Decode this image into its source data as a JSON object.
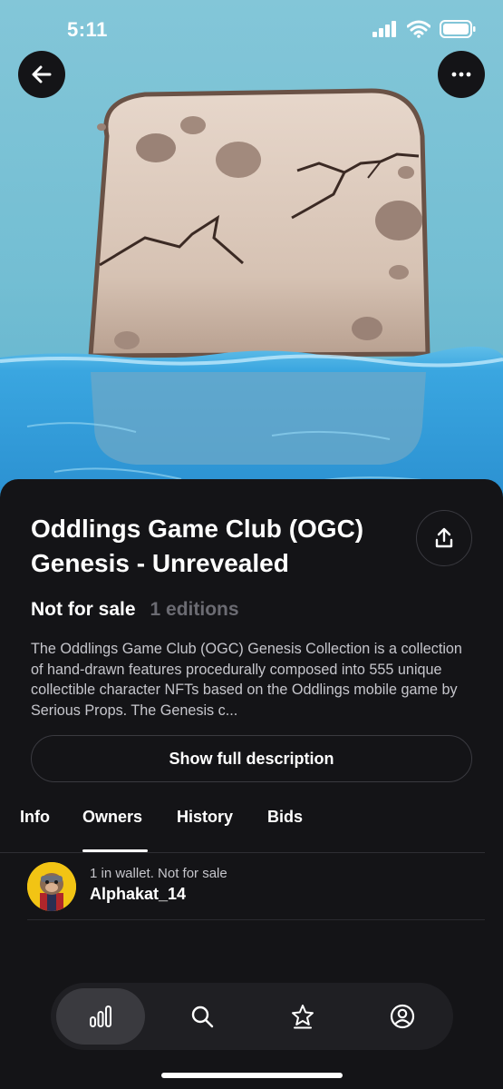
{
  "status_bar": {
    "time": "5:11",
    "icons": [
      "cellular-signal-icon",
      "wifi-icon",
      "battery-icon"
    ]
  },
  "hero": {
    "description_icons": [
      "back-arrow-icon",
      "more-dots-icon"
    ]
  },
  "nft": {
    "title": "Oddlings Game Club (OGC) Genesis - Unrevealed",
    "sale_status": "Not for sale",
    "editions": "1 editions",
    "description": "The Oddlings Game Club (OGC) Genesis Collection is a collection of hand-drawn features procedurally composed into 555 unique collectible character NFTs based on the Oddlings mobile game by Serious Props.  The Genesis c...",
    "show_description_label": "Show full description"
  },
  "tabs": [
    {
      "label": "Info",
      "active": false
    },
    {
      "label": "Owners",
      "active": true
    },
    {
      "label": "History",
      "active": false
    },
    {
      "label": "Bids",
      "active": false
    }
  ],
  "owners": [
    {
      "meta": "1 in wallet. Not for sale",
      "name": "Alphakat_14"
    }
  ],
  "bottom_nav": {
    "items": [
      "activity-icon",
      "search-icon",
      "watchlist-star-icon",
      "profile-icon"
    ],
    "active": "activity-icon"
  },
  "colors": {
    "background": "#141417",
    "sheet": "#141417",
    "muted_text": "#6b6b72",
    "border": "#3a3a40",
    "sky": "#7cc3d6",
    "water": "#2f9fd8"
  }
}
